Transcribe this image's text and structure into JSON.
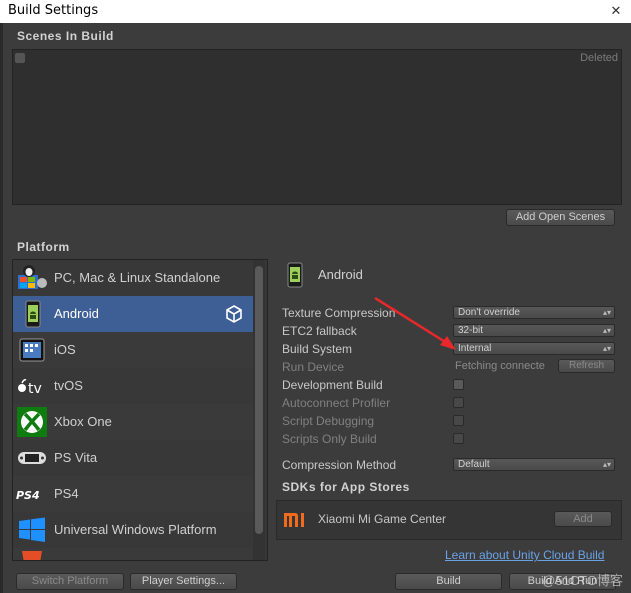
{
  "window": {
    "title": "Build Settings",
    "close_glyph": "✕"
  },
  "scenes": {
    "header": "Scenes In Build",
    "deleted_label": "Deleted",
    "add_open_scenes": "Add Open Scenes"
  },
  "platform": {
    "header": "Platform",
    "items": [
      {
        "label": "PC, Mac & Linux Standalone",
        "icon": "pc-mac-linux-icon",
        "selected": false
      },
      {
        "label": "Android",
        "icon": "android-icon",
        "selected": true
      },
      {
        "label": "iOS",
        "icon": "ios-icon",
        "selected": false
      },
      {
        "label": "tvOS",
        "icon": "appletv-icon",
        "selected": false
      },
      {
        "label": "Xbox One",
        "icon": "xbox-icon",
        "selected": false
      },
      {
        "label": "PS Vita",
        "icon": "psvita-icon",
        "selected": false
      },
      {
        "label": "PS4",
        "icon": "ps4-icon",
        "selected": false
      },
      {
        "label": "Universal Windows Platform",
        "icon": "windows-icon",
        "selected": false
      },
      {
        "label": "",
        "icon": "html5-icon",
        "selected": false
      }
    ]
  },
  "settings": {
    "platform_title": "Android",
    "texture_compression": {
      "label": "Texture Compression",
      "value": "Don't override"
    },
    "etc2_fallback": {
      "label": "ETC2 fallback",
      "value": "32-bit"
    },
    "build_system": {
      "label": "Build System",
      "value": "Internal"
    },
    "run_device": {
      "label": "Run Device",
      "value": "Fetching connecte",
      "refresh": "Refresh"
    },
    "development_build": {
      "label": "Development Build"
    },
    "autoconnect_profiler": {
      "label": "Autoconnect Profiler"
    },
    "script_debugging": {
      "label": "Script Debugging"
    },
    "scripts_only_build": {
      "label": "Scripts Only Build"
    },
    "compression_method": {
      "label": "Compression Method",
      "value": "Default"
    },
    "sdk_header": "SDKs for App Stores",
    "sdk_item": {
      "label": "Xiaomi Mi Game Center",
      "add": "Add"
    }
  },
  "footer": {
    "cloud_link": "Learn about Unity Cloud Build",
    "switch_platform": "Switch Platform",
    "player_settings": "Player Settings...",
    "build": "Build",
    "build_and_run": "Build And Run"
  },
  "watermark": "@51CTO博客",
  "colors": {
    "selection": "#3e5f96",
    "link": "#6aa2e8",
    "annotation_arrow": "#e8282a"
  }
}
